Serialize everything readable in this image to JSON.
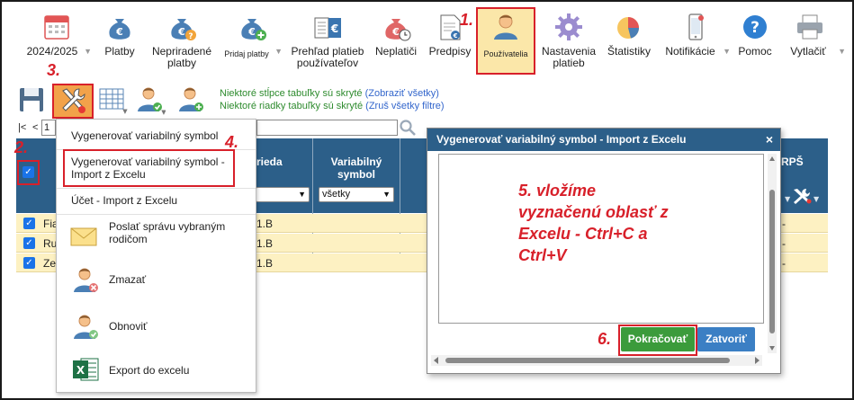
{
  "toolbar": {
    "items": [
      {
        "label": "2024/2025",
        "has_arrow": true
      },
      {
        "label": "Platby"
      },
      {
        "label": "Nepriradené\nplatby"
      },
      {
        "label": "Pridaj platby",
        "has_arrow": true
      },
      {
        "label": "Prehľad platieb\npoužívateľov"
      },
      {
        "label": "Neplatiči"
      },
      {
        "label": "Predpisy"
      },
      {
        "label": "Používatelia"
      },
      {
        "label": "Nastavenia\nplatieb"
      },
      {
        "label": "Štatistiky"
      },
      {
        "label": "Notifikácie",
        "has_arrow": true
      },
      {
        "label": "Pomoc"
      },
      {
        "label": "Vytlačiť",
        "has_arrow": true
      }
    ],
    "active_index": 7
  },
  "info": {
    "columns_hidden": "Niektoré stĺpce tabuľky sú skryté",
    "columns_link": "(Zobraziť všetky)",
    "rows_hidden": "Niektoré riadky tabuľky sú skryté",
    "rows_link": "(Zruš všetky filtre)"
  },
  "pager": {
    "first": "|<",
    "prev": "<",
    "page_value": "1"
  },
  "table": {
    "headers": {
      "class": "rieda",
      "vs_line1": "Variabilný",
      "vs_line2": "symbol",
      "last": "RPŠ"
    },
    "vs_filter": "všetky",
    "rows": [
      {
        "name": "Fia",
        "class": "1.B",
        "end": "-"
      },
      {
        "name": "Ru",
        "class": "1.B",
        "end": "-"
      },
      {
        "name": "Ze",
        "class": "1.B",
        "end": "-"
      }
    ]
  },
  "menu": {
    "items": [
      {
        "label": "Vygenerovať variabilný symbol"
      },
      {
        "label": "Vygenerovať variabilný symbol -\nImport z Excelu"
      },
      {
        "label": "Účet - Import z Excelu"
      },
      {
        "label": "Poslať správu vybraným\nrodičom"
      },
      {
        "label": "Zmazať"
      },
      {
        "label": "Obnoviť"
      },
      {
        "label": "Export do excelu"
      }
    ]
  },
  "dialog": {
    "title": "Vygenerovať variabilný symbol - Import z Excelu",
    "close": "×",
    "textarea_value": "",
    "continue_label": "Pokračovať",
    "close_label": "Zatvoriť"
  },
  "annotations": {
    "a1": "1.",
    "a2": "2.",
    "a3": "3.",
    "a4": "4.",
    "a5": "5. vložíme\nvyznačenú oblasť z\nExcelu - Ctrl+C a\nCtrl+V",
    "a6": "6."
  },
  "colors": {
    "header_blue": "#2c5f89",
    "annotation_red": "#d8202a",
    "active_bg": "#fbe7a9",
    "row_yellow": "#fdf1c2",
    "continue_green": "#3b9b3b",
    "close_blue": "#3b7fc4"
  }
}
